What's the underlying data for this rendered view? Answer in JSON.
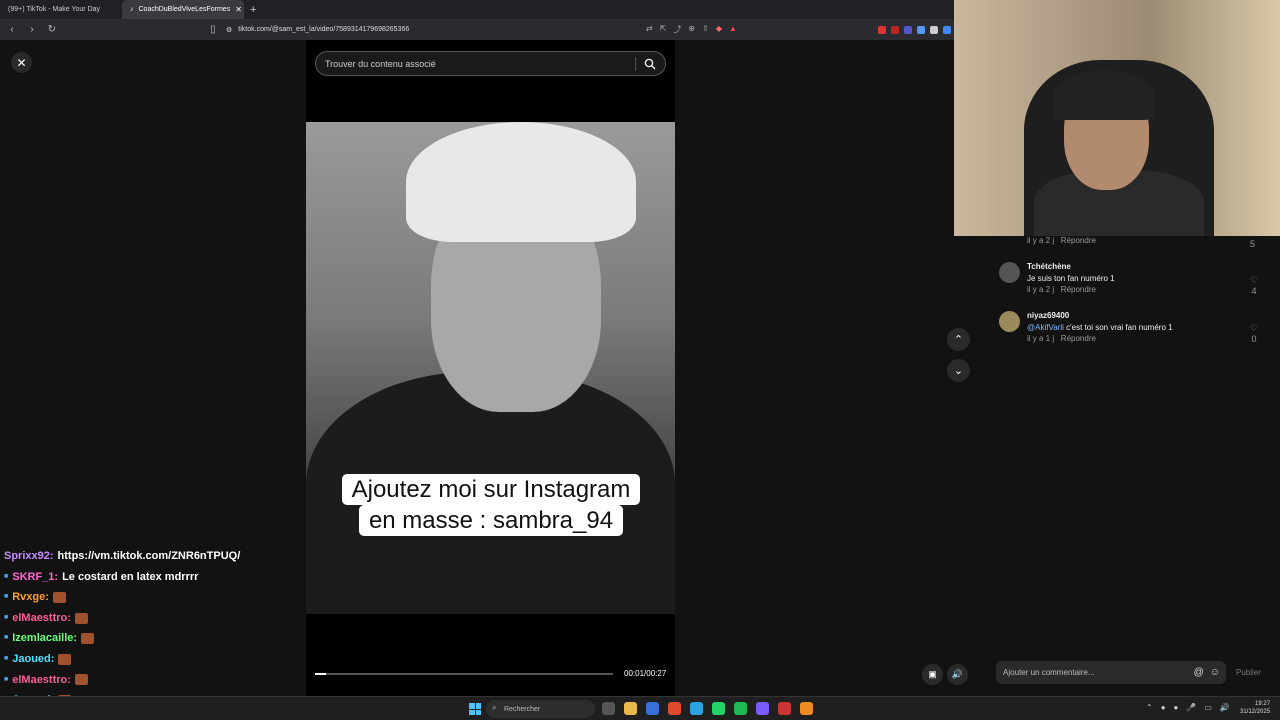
{
  "browser": {
    "tabs": [
      {
        "label": "(99+) TikTok - Make Your Day",
        "active": false
      },
      {
        "label": "CoachDuBledViveLesFormes",
        "active": true
      }
    ],
    "url": "tiktok.com/@sam_est_la/video/7589314179698265366"
  },
  "viewer": {
    "search_placeholder": "Trouver du contenu associé",
    "caption_line1": "Ajoutez moi sur Instagram",
    "caption_line2": "en masse : sambra_94",
    "time": "00:01/00:27",
    "progress": 0.037
  },
  "chat": [
    {
      "user": "Sprixx92:",
      "color": "#c58cff",
      "text": "https://vm.tiktok.com/ZNR6nTPUQ/",
      "emote": false
    },
    {
      "user": "SKRF_1:",
      "color": "#ff66d4",
      "text": "Le costard en latex mdrrrr",
      "emote": false
    },
    {
      "user": "Rvxge:",
      "color": "#ff9d2e",
      "text": "",
      "emote": true
    },
    {
      "user": "elMaesttro:",
      "color": "#ff5a9b",
      "text": "",
      "emote": true
    },
    {
      "user": "Izemlacaille:",
      "color": "#6bff7a",
      "text": "",
      "emote": true
    },
    {
      "user": "Jaoued:",
      "color": "#4fe0ff",
      "text": "",
      "emote": true
    },
    {
      "user": "elMaesttro:",
      "color": "#ff5a9b",
      "text": "",
      "emote": true
    },
    {
      "user": "Jaoued:",
      "color": "#4fe0ff",
      "text": "",
      "emote": true
    }
  ],
  "comments": [
    {
      "user": "",
      "text": "",
      "meta": "il y a 2 j",
      "reply": "Répondre",
      "likes": "5"
    },
    {
      "user": "Tchétchène",
      "text": "Je suis ton fan numéro 1",
      "meta": "il y a 2 j",
      "reply": "Répondre",
      "likes": "4"
    },
    {
      "user": "niyaz69400",
      "mention": "@AkifVarli",
      "text": " c'est toi son vrai fan numéro 1",
      "meta": "il y a 1 j",
      "reply": "Répondre",
      "likes": "0"
    }
  ],
  "comment_input": {
    "placeholder": "Ajouter un commentaire...",
    "publish": "Publier"
  },
  "taskbar": {
    "search": "Rechercher",
    "time": "19:27",
    "date": "31/12/2025"
  }
}
